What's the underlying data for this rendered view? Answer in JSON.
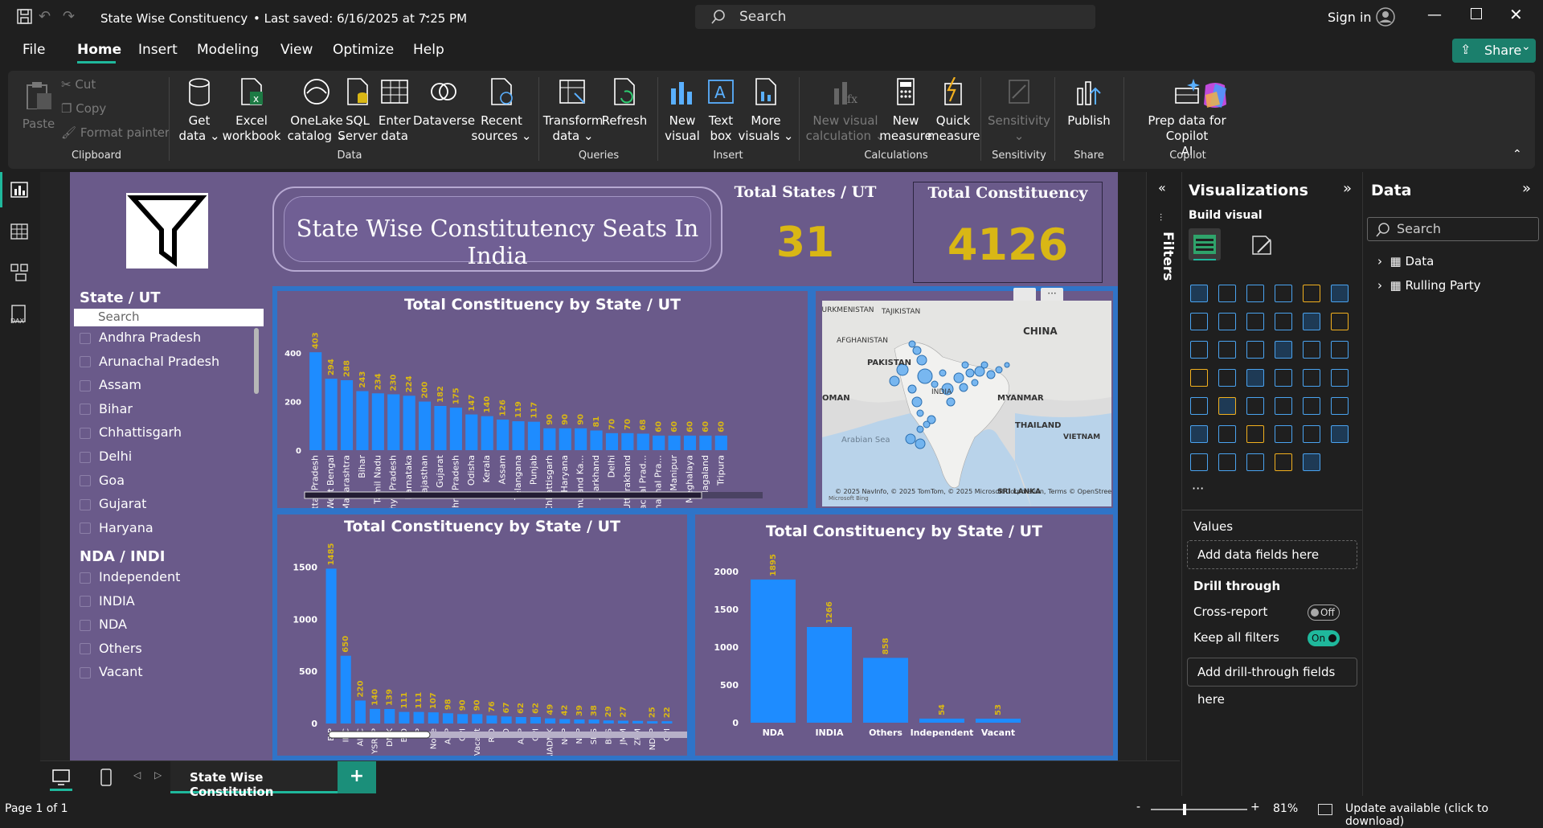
{
  "titlebar": {
    "title": "State Wise Constituency",
    "saved": "• Last saved: 6/16/2025 at 7:25 PM",
    "search_placeholder": "Search",
    "sign_in": "Sign in"
  },
  "menu": {
    "items": [
      "File",
      "Home",
      "Insert",
      "Modeling",
      "View",
      "Optimize",
      "Help"
    ],
    "active": "Home",
    "share_label": "Share"
  },
  "ribbon": {
    "clipboard": {
      "paste": "Paste",
      "cut": "Cut",
      "copy": "Copy",
      "format_painter": "Format painter",
      "group": "Clipboard"
    },
    "data": {
      "get_data": [
        "Get",
        "data ⌄"
      ],
      "excel": [
        "Excel",
        "workbook"
      ],
      "onelake": [
        "OneLake",
        "catalog ⌄"
      ],
      "sql": [
        "SQL",
        "Server"
      ],
      "enter": [
        "Enter",
        "data"
      ],
      "dataverse": [
        "Dataverse",
        ""
      ],
      "recent": [
        "Recent",
        "sources ⌄"
      ],
      "group": "Data"
    },
    "queries": {
      "transform": [
        "Transform",
        "data ⌄"
      ],
      "refresh": [
        "Refresh",
        ""
      ],
      "group": "Queries"
    },
    "insert": {
      "new_visual": [
        "New",
        "visual"
      ],
      "text_box": [
        "Text",
        "box"
      ],
      "more_visuals": [
        "More",
        "visuals ⌄"
      ],
      "group": "Insert"
    },
    "calculations": {
      "new_visual_calc": [
        "New visual",
        "calculation ⌄"
      ],
      "new_measure": [
        "New",
        "measure"
      ],
      "quick_measure": [
        "Quick",
        "measure"
      ],
      "group": "Calculations"
    },
    "sensitivity": {
      "label": [
        "Sensitivity",
        "⌄"
      ],
      "group": "Sensitivity"
    },
    "share": {
      "publish": "Publish",
      "group": "Share"
    },
    "copilot": {
      "prep": [
        "Prep data for Copilot",
        "AI"
      ],
      "group": "Copilot"
    }
  },
  "report": {
    "main_title": "State Wise Constitutency Seats In India",
    "kpi_states_label": "Total States / UT",
    "kpi_states_value": "31",
    "kpi_const_label": "Total Constituency",
    "kpi_const_value": "4126",
    "slicer1": {
      "title": "State / UT",
      "search_placeholder": "Search",
      "items": [
        "Andhra Pradesh",
        "Arunachal Pradesh",
        "Assam",
        "Bihar",
        "Chhattisgarh",
        "Delhi",
        "Goa",
        "Gujarat",
        "Haryana"
      ]
    },
    "slicer2": {
      "title": "NDA / INDI",
      "items": [
        "Independent",
        "INDIA",
        "NDA",
        "Others",
        "Vacant"
      ]
    },
    "map": {
      "labels": [
        "TURKMENISTAN",
        "TAJIKISTAN",
        "AFGHANISTAN",
        "CHINA",
        "PAKISTAN",
        "INDIA",
        "OMAN",
        "MYANMAR",
        "THAILAND",
        "VIETNAM",
        "Arabian Sea",
        "SRI LANKA"
      ],
      "attribution": "© 2025 NavInfo, © 2025 TomTom, © 2025 Microsoft Corporation, Terms © OpenStreetMap",
      "brand": "Microsoft Bing"
    }
  },
  "chart_data": [
    {
      "type": "bar",
      "title": "Total Constituency by State / UT",
      "categories": [
        "Uttar Pradesh",
        "West Bengal",
        "Maharashtra",
        "Bihar",
        "Tamil Nadu",
        "Madhya Pradesh",
        "Karnataka",
        "Rajasthan",
        "Gujarat",
        "Andhra Pradesh",
        "Odisha",
        "Kerala",
        "Assam",
        "Telangana",
        "Punjab",
        "Chhattisgarh",
        "Haryana",
        "Jammu and Ka...",
        "Jharkhand",
        "Delhi",
        "Uttarakhand",
        "Himachal Prad...",
        "Arunachal Pra...",
        "Manipur",
        "Meghalaya",
        "Nagaland",
        "Tripura"
      ],
      "values": [
        403,
        294,
        288,
        243,
        234,
        230,
        224,
        200,
        182,
        175,
        147,
        140,
        126,
        119,
        117,
        90,
        90,
        90,
        81,
        70,
        70,
        68,
        60,
        60,
        60,
        60,
        60
      ],
      "yticks": [
        0,
        200,
        400
      ],
      "ylim": [
        0,
        450
      ],
      "grid": false
    },
    {
      "type": "bar",
      "title": "Total Constituency by State / UT",
      "categories": [
        "BJP",
        "INC",
        "AITC",
        "YSRCP",
        "DMK",
        "BJD",
        "SP",
        "None",
        "AAP",
        "CPI",
        "Vacant",
        "RJD",
        "JD",
        "AAP",
        "CPI",
        "AIADMK",
        "NCP",
        "NPP",
        "SHS",
        "BRS",
        "JMM",
        "ZPM",
        "NDPP",
        "CPI"
      ],
      "values": [
        1485,
        650,
        220,
        140,
        139,
        111,
        111,
        107,
        98,
        90,
        90,
        76,
        67,
        62,
        62,
        49,
        42,
        39,
        38,
        29,
        27,
        25,
        22,
        22
      ],
      "labels": [
        "1485",
        "650",
        "220",
        "140",
        "139",
        "111",
        "111",
        "107",
        "98",
        "90",
        "90",
        "76",
        "67",
        "62",
        "62",
        "49",
        "42",
        "39",
        "38",
        "29",
        "27",
        "",
        "25",
        "22"
      ],
      "yticks": [
        0,
        500,
        1000,
        1500
      ],
      "ylim": [
        0,
        1650
      ],
      "grid": false
    },
    {
      "type": "bar",
      "title": "Total Constituency by State / UT",
      "categories": [
        "NDA",
        "INDIA",
        "Others",
        "Independent",
        "Vacant"
      ],
      "values": [
        1895,
        1266,
        858,
        54,
        53
      ],
      "yticks": [
        0,
        500,
        1000,
        1500,
        2000
      ],
      "ylim": [
        0,
        2000
      ],
      "grid": false
    }
  ],
  "filters": {
    "label": "Filters"
  },
  "viz_pane": {
    "title": "Visualizations",
    "build": "Build visual",
    "values_label": "Values",
    "values_placeholder": "Add data fields here",
    "drill": "Drill through",
    "cross_report": "Cross-report",
    "cross_state": "Off",
    "keep_filters": "Keep all filters",
    "keep_state": "On",
    "drill_placeholder": "Add drill-through fields here"
  },
  "data_pane": {
    "title": "Data",
    "search_placeholder": "Search",
    "tables": [
      "Data",
      "Rulling Party"
    ]
  },
  "tabs": {
    "page_name": "State Wise Constitution",
    "add": "+"
  },
  "status": {
    "page": "Page 1 of 1",
    "zoom": "81%",
    "update": "Update available (click to download)"
  },
  "colors": {
    "accent": "#1e8cff",
    "label": "#d9b715",
    "report_bg": "#6a5a8a",
    "panel_border": "#2f74c8"
  }
}
